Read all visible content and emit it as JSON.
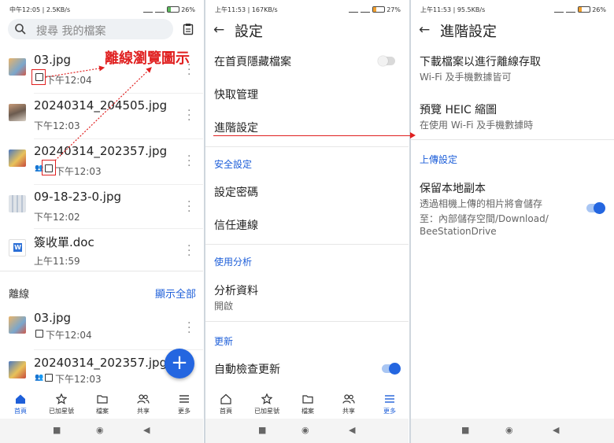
{
  "panel1": {
    "status": {
      "left": "中午12:05 | 2.5KB/s",
      "battery": "26"
    },
    "search": {
      "placeholder": "搜尋 我的檔案"
    },
    "annotation": "離線瀏覽圖示",
    "files": [
      {
        "name": "03.jpg",
        "time": "下午12:04"
      },
      {
        "name": "20240314_204505.jpg",
        "time": "下午12:03"
      },
      {
        "name": "20240314_202357.jpg",
        "time": "下午12:03"
      },
      {
        "name": "09-18-23-0.jpg",
        "time": "下午12:02"
      },
      {
        "name": "簽收單.doc",
        "time": "上午11:59"
      }
    ],
    "offline_section": {
      "title": "離線",
      "show_all": "顯示全部"
    },
    "offline_files": [
      {
        "name": "03.jpg",
        "time": "下午12:04"
      },
      {
        "name": "20240314_202357.jpg",
        "time": "下午12:03"
      }
    ],
    "fab_label": "+",
    "nav": [
      "首頁",
      "已加星號",
      "檔案",
      "共享",
      "更多"
    ],
    "active_nav": "首頁"
  },
  "panel2": {
    "status": {
      "left": "上午11:53 | 167KB/s",
      "battery": "27"
    },
    "title": "設定",
    "rows": {
      "hide_files": "在首頁隱藏檔案",
      "cache": "快取管理",
      "advanced": "進階設定",
      "security_header": "安全設定",
      "set_password": "設定密碼",
      "trusted": "信任連線",
      "analytics_header": "使用分析",
      "analytics": "分析資料",
      "analytics_sub": "開啟",
      "update_header": "更新",
      "auto_update": "自動檢查更新"
    },
    "toggles": {
      "hide_files": false,
      "auto_update": true
    },
    "nav": [
      "首頁",
      "已加星號",
      "檔案",
      "共享",
      "更多"
    ],
    "active_nav": "更多"
  },
  "panel3": {
    "status": {
      "left": "上午11:53 | 95.5KB/s",
      "battery": "26"
    },
    "title": "進階設定",
    "download_title": "下載檔案以進行離線存取",
    "download_sub": "Wi-Fi 及手機數據皆可",
    "heic_title": "預覽 HEIC 縮圖",
    "heic_sub": "在使用 Wi-Fi 及手機數據時",
    "upload_header": "上傳設定",
    "keep_title": "保留本地副本",
    "keep_sub1": "透過相機上傳的相片將會儲存",
    "keep_sub2": "至：內部儲存空間/Download/",
    "keep_sub3": "BeeStationDrive",
    "toggles": {
      "keep_local": true
    }
  },
  "colors": {
    "accent": "#2466e0",
    "annotation": "#e02020"
  }
}
